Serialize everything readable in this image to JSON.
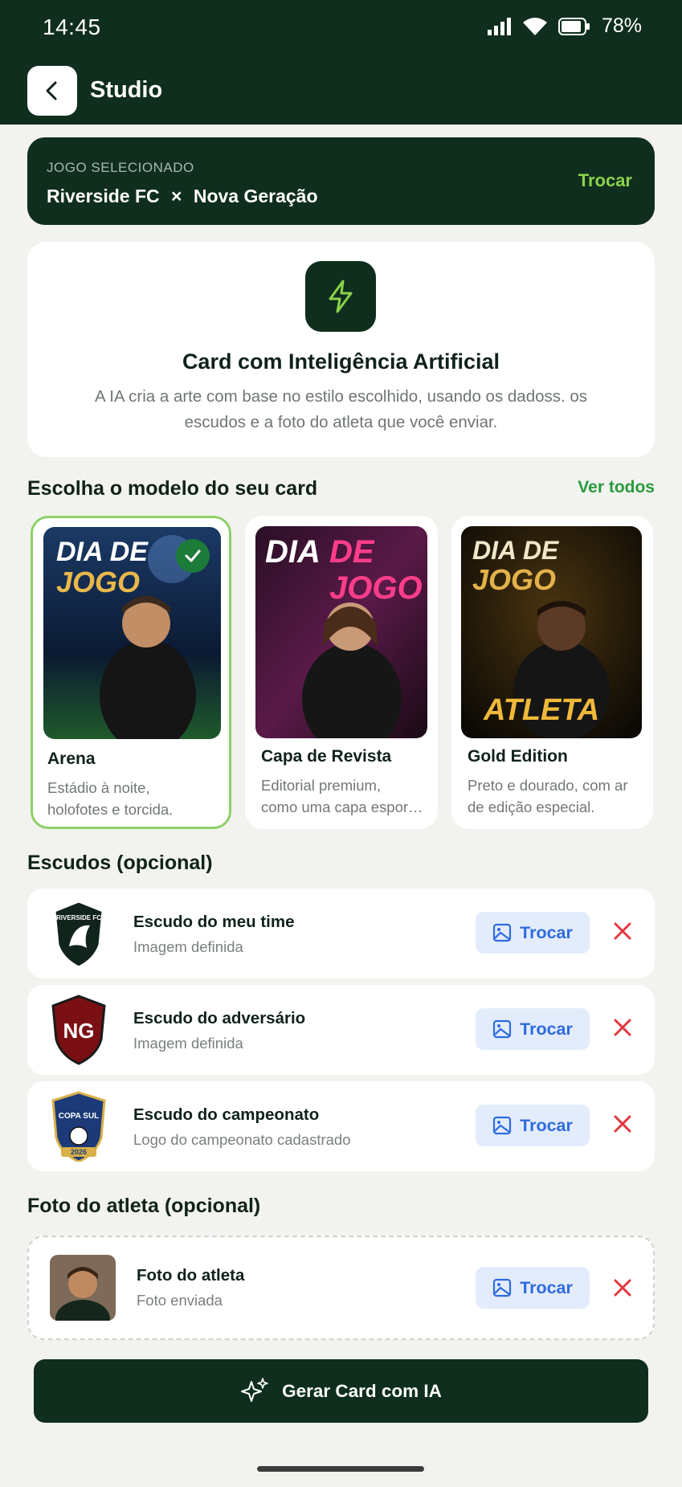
{
  "status_bar": {
    "time": "14:45",
    "battery": "78%"
  },
  "header": {
    "title": "Studio"
  },
  "game": {
    "label": "JOGO SELECIONADO",
    "home": "Riverside FC",
    "separator": "×",
    "away": "Nova Geração",
    "swap_label": "Trocar"
  },
  "ai_card": {
    "title": "Card com Inteligência Artificial",
    "description": "A IA cria a arte com base no estilo escolhido, usando os dadoss. os escudos e a foto do atleta que você enviar."
  },
  "templates_section": {
    "title": "Escolha o modelo do seu card",
    "see_all": "Ver todos"
  },
  "templates": [
    {
      "name": "Arena",
      "desc1": "Estádio à noite,",
      "desc2": "holofotes e torcida.",
      "thumb_line1": "DIA DE",
      "thumb_line2": "JOGO",
      "selected": true
    },
    {
      "name": "Capa de Revista",
      "desc1": "Editorial premium,",
      "desc2": "como uma capa espor…",
      "thumb_line1": "DIA",
      "thumb_line2": "DE JOGO",
      "selected": false
    },
    {
      "name": "Gold Edition",
      "desc1": "Preto e dourado, com ar",
      "desc2": "de edição especial.",
      "thumb_line1": "DIA DE",
      "thumb_line2": "JOGO",
      "thumb_line3": "ATLETA",
      "selected": false
    }
  ],
  "crests_section": {
    "title": "Escudos (opcional)"
  },
  "crests": [
    {
      "title": "Escudo do meu time",
      "sub": "Imagem definida",
      "logo_text": "RIVERSIDE FC",
      "swap": "Trocar"
    },
    {
      "title": "Escudo do adversário",
      "sub": "Imagem definida",
      "logo_text": "NG",
      "swap": "Trocar"
    },
    {
      "title": "Escudo do campeonato",
      "sub": "Logo do campeonato cadastrado",
      "logo_text": "COPA SUL",
      "logo_year": "2026",
      "swap": "Trocar"
    }
  ],
  "photo_section": {
    "title": "Foto do atleta (opcional)"
  },
  "photo": {
    "title": "Foto do atleta",
    "sub": "Foto enviada",
    "swap": "Trocar"
  },
  "generate": {
    "label": "Gerar Card com IA"
  },
  "colors": {
    "primary": "#0f2e1e",
    "accent": "#8bd34b",
    "link": "#2a9a3f",
    "button_bg": "#e3ecfb",
    "button_text": "#2f6be0",
    "danger": "#e0393e"
  }
}
